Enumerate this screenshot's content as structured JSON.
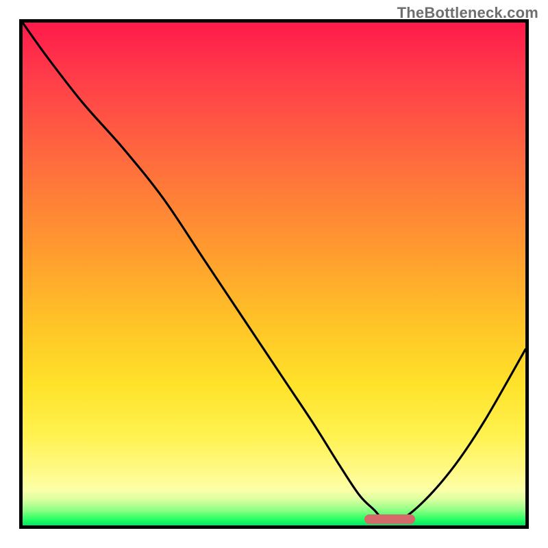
{
  "watermark": "TheBottleneck.com",
  "chart_data": {
    "type": "line",
    "title": "",
    "xlabel": "",
    "ylabel": "",
    "xlim": [
      0,
      100
    ],
    "ylim": [
      0,
      100
    ],
    "x": [
      0,
      5,
      12,
      20,
      28,
      36,
      44,
      52,
      58,
      63,
      67,
      70,
      72,
      75,
      80,
      86,
      92,
      100
    ],
    "values": [
      100,
      93,
      84,
      75,
      65,
      53,
      41,
      29,
      20,
      12,
      6,
      3,
      1,
      1,
      5,
      12,
      21,
      35
    ],
    "optimal_range_x": [
      68,
      78
    ],
    "gradient_stops": [
      {
        "pos": 0.0,
        "color": "#ff1a4a"
      },
      {
        "pos": 0.5,
        "color": "#ffb62c"
      },
      {
        "pos": 0.85,
        "color": "#fff24f"
      },
      {
        "pos": 1.0,
        "color": "#00e864"
      }
    ],
    "marker_color": "#d46a6a"
  }
}
